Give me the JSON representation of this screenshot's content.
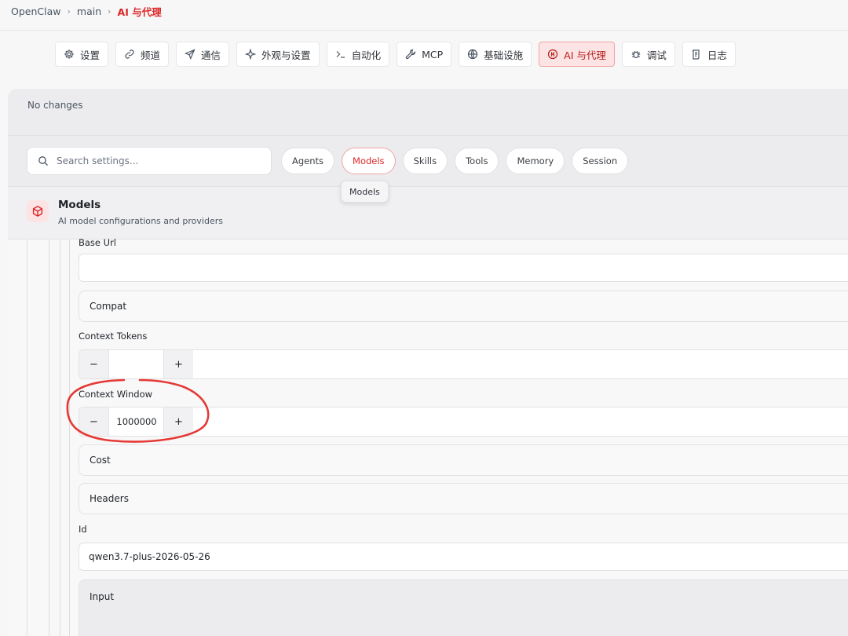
{
  "breadcrumb": {
    "items": [
      "OpenClaw",
      "main"
    ],
    "current": "AI 与代理",
    "separator": "›"
  },
  "tabs": [
    {
      "label": "设置",
      "icon": "gear-icon",
      "active": false
    },
    {
      "label": "频道",
      "icon": "link-icon",
      "active": false
    },
    {
      "label": "通信",
      "icon": "send-icon",
      "active": false
    },
    {
      "label": "外观与设置",
      "icon": "sparkle-icon",
      "active": false
    },
    {
      "label": "自动化",
      "icon": "terminal-icon",
      "active": false
    },
    {
      "label": "MCP",
      "icon": "wrench-icon",
      "active": false
    },
    {
      "label": "基础设施",
      "icon": "globe-icon",
      "active": false
    },
    {
      "label": "AI 与代理",
      "icon": "ai-icon",
      "active": true
    },
    {
      "label": "调试",
      "icon": "bug-icon",
      "active": false
    },
    {
      "label": "日志",
      "icon": "scroll-icon",
      "active": false
    }
  ],
  "status": {
    "text": "No changes"
  },
  "search": {
    "placeholder": "Search settings...",
    "value": ""
  },
  "filters": [
    {
      "label": "Agents",
      "active": false
    },
    {
      "label": "Models",
      "active": true
    },
    {
      "label": "Skills",
      "active": false
    },
    {
      "label": "Tools",
      "active": false
    },
    {
      "label": "Memory",
      "active": false
    },
    {
      "label": "Session",
      "active": false
    }
  ],
  "tooltip": {
    "text": "Models"
  },
  "section": {
    "title": "Models",
    "subtitle": "AI model configurations and providers",
    "icon": "cube-icon"
  },
  "fields": {
    "base_url": {
      "label": "Base Url",
      "value": ""
    },
    "compat": {
      "label": "Compat"
    },
    "context_tokens": {
      "label": "Context Tokens",
      "value": "",
      "minus": "−",
      "plus": "+"
    },
    "context_window": {
      "label": "Context Window",
      "value": "1000000",
      "minus": "−",
      "plus": "+"
    },
    "cost": {
      "label": "Cost"
    },
    "headers": {
      "label": "Headers"
    },
    "id": {
      "label": "Id",
      "value": "qwen3.7-plus-2026-05-26"
    },
    "input": {
      "label": "Input"
    }
  },
  "colors": {
    "accent": "#dc2626",
    "annotation": "#e53935"
  }
}
